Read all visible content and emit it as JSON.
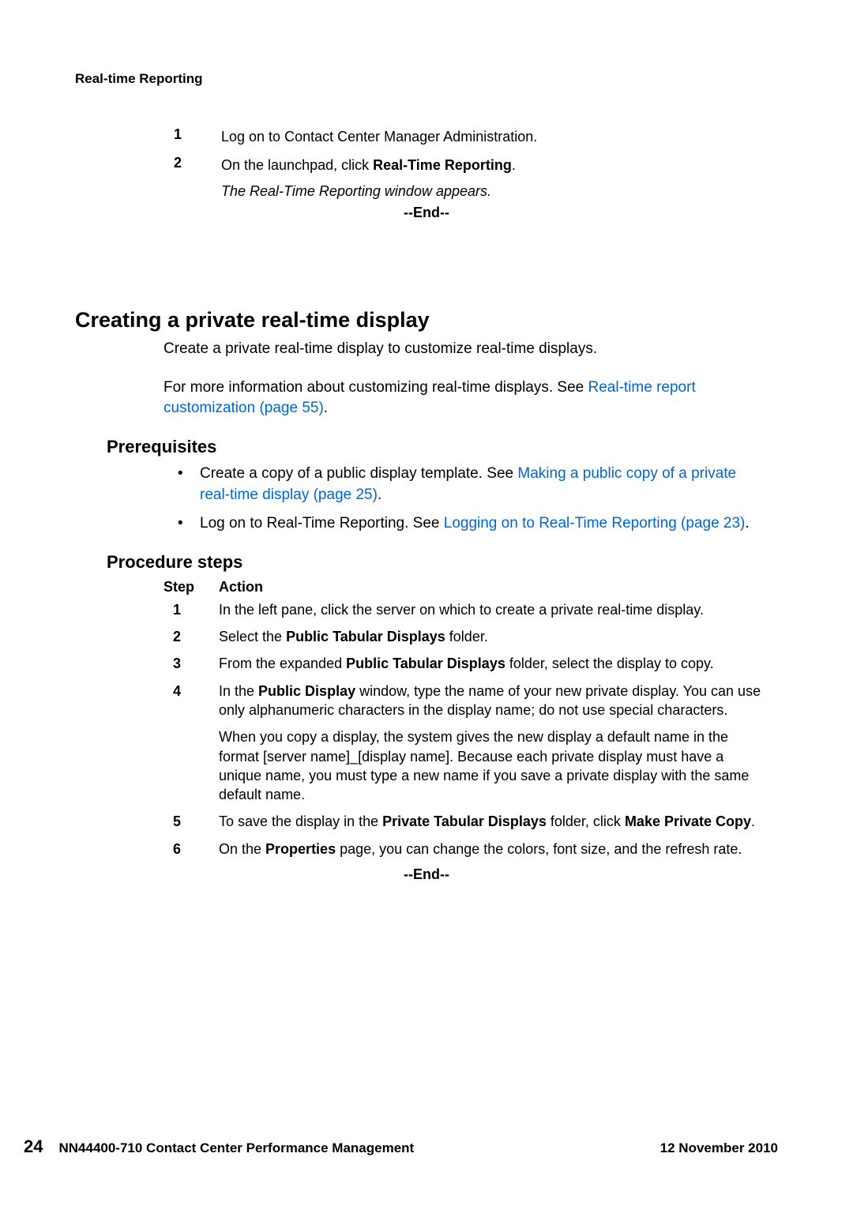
{
  "header": {
    "title": "Real-time Reporting"
  },
  "top_steps": {
    "items": [
      {
        "num": "1",
        "text": "Log on to Contact Center Manager Administration."
      },
      {
        "num": "2",
        "pre": "On the launchpad, click ",
        "bold": "Real-Time Reporting",
        "post": "."
      }
    ],
    "result": "The Real-Time Reporting window appears.",
    "end": "--End--"
  },
  "section": {
    "heading": "Creating a private real-time display",
    "para1": "Create a private real-time display to customize real-time displays.",
    "para2_pre": "For more information about customizing real-time displays. See ",
    "para2_link": "Real-time report customization (page 55)",
    "para2_post": "."
  },
  "prereq": {
    "heading": "Prerequisites",
    "items": [
      {
        "pre": "Create a copy of a public display template. See ",
        "link": "Making a public copy of a private real-time display (page 25)",
        "post": "."
      },
      {
        "pre": "Log on to Real-Time Reporting. See ",
        "link": "Logging on to Real-Time Reporting (page 23)",
        "post": "."
      }
    ]
  },
  "procedure": {
    "heading": "Procedure steps",
    "col_step": "Step",
    "col_action": "Action",
    "steps": {
      "s1": {
        "num": "1",
        "text": "In the left pane, click the server on which to create a private real-time display."
      },
      "s2": {
        "num": "2",
        "pre": "Select the ",
        "b1": "Public Tabular Displays",
        "post": " folder."
      },
      "s3": {
        "num": "3",
        "pre": "From the expanded ",
        "b1": "Public Tabular Displays",
        "post": " folder, select the display to copy."
      },
      "s4": {
        "num": "4",
        "pre": "In the ",
        "b1": "Public Display",
        "post": " window, type the name of your new private display. You can use only alphanumeric characters in the display name; do not use special characters.",
        "sub": "When you copy a display, the system gives the new display a default name in the format [server name]_[display name]. Because each private display must have a unique name, you must type a new name if you save a private display with the same default name."
      },
      "s5": {
        "num": "5",
        "pre": "To save the display in the ",
        "b1": "Private Tabular Displays",
        "mid": " folder, click ",
        "b2": "Make Private Copy",
        "post": "."
      },
      "s6": {
        "num": "6",
        "pre": "On the ",
        "b1": "Properties",
        "post": " page, you can change the colors, font size, and the refresh rate."
      }
    },
    "end": "--End--"
  },
  "footer": {
    "page": "24",
    "doc": "NN44400-710 Contact Center Performance Management",
    "date": "12 November 2010"
  }
}
